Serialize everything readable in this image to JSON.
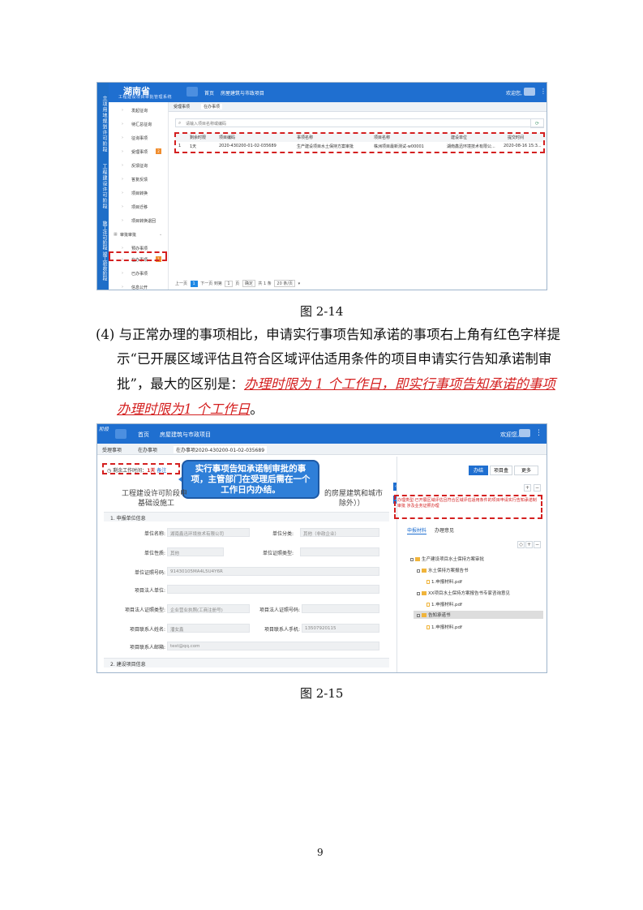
{
  "figure1": {
    "caption": "图 2-14",
    "side_labels": [
      "立项用地规划许可阶段",
      "工程建设许可阶段",
      "施工许可阶段",
      "竣工验收阶段"
    ],
    "header": {
      "logo": "湖南省",
      "logo_sub": "工程建设项目审批管理系统",
      "nav": [
        "首页",
        "房屋建筑与市政项目"
      ],
      "welcome": "欢迎您,"
    },
    "sidebar": [
      {
        "label": "发起征询",
        "badge": ""
      },
      {
        "label": "待汇总征询",
        "badge": ""
      },
      {
        "label": "征询事项",
        "badge": ""
      },
      {
        "label": "受理事项",
        "badge": "2"
      },
      {
        "label": "反馈征询",
        "badge": ""
      },
      {
        "label": "答复反馈",
        "badge": ""
      },
      {
        "label": "项目转换",
        "badge": ""
      },
      {
        "label": "项目迁移",
        "badge": ""
      },
      {
        "label": "项目转换退回",
        "badge": ""
      },
      {
        "label": "审批审批",
        "badge": ""
      },
      {
        "label": "预办事项",
        "badge": ""
      },
      {
        "label": "在办事项",
        "badge": "1"
      },
      {
        "label": "已办事项",
        "badge": ""
      },
      {
        "label": "信息公开",
        "badge": ""
      }
    ],
    "tabs": [
      "受理事项",
      "在办事项"
    ],
    "search_placeholder": "请输入项目名称或编码",
    "table": {
      "headers": [
        "剩余时限",
        "项目编码",
        "事项名称",
        "项目名称",
        "建设单位",
        "提交时间"
      ],
      "rows": [
        [
          "1",
          "1天",
          "2020-430200-01-02-035689",
          "生产建设项目水土保持方案审批",
          "株洲项目最新测试-w00001",
          "湖南鑫迅环境技术有限公...",
          "2020-08-16 15:3..."
        ]
      ]
    },
    "pager": {
      "prev": "上一页",
      "page": "1",
      "next": "下一页",
      "goto": "到第",
      "goto_val": "1",
      "page_unit": "页",
      "confirm": "确定",
      "total": "共 1 条",
      "per_page": "20 条/页"
    }
  },
  "paragraph": {
    "line1": "(4) 与正常办理的事项相比，申请实行事项告知承诺的事项右上角有红色字样提",
    "line2": "示“已开展区域评估且符合区域评估适用条件的项目申请实行告知承诺制审",
    "line3_prefix": "批”，最大的区别是：",
    "line3_red": "办理时限为 1 个工作日，即实行事项告知承诺的事项",
    "line4_red": "办理时限为1 个工作日",
    "line4_suffix": "。"
  },
  "figure2": {
    "caption": "图 2-15",
    "header": {
      "logo": "阶段",
      "nav": [
        "首页",
        "房屋建筑与市政项目"
      ],
      "welcome": "欢迎您,"
    },
    "tabs": [
      "受理事项",
      "在办事项",
      "在办事项2020-430200-01-02-035689"
    ],
    "time_label": "剩余工作时间：",
    "time_days": "1天",
    "time_note": "备注",
    "callout": "实行事项告知承诺制审批的事项，主管部门在受理后需在一个工作日内办结。",
    "form_title_l1": "工程建设许可阶段申",
    "form_title_l2": "基础设施工",
    "form_title_r1": "的房屋建筑和城市",
    "form_title_r2": "除外））",
    "sections": [
      "1. 申报单位信息",
      "2. 建设项目信息"
    ],
    "fields": [
      {
        "label": "单位名称:",
        "value": "湖南鑫迅环境技术有限公司"
      },
      {
        "label": "单位分类:",
        "value": "其他（非政企业）"
      },
      {
        "label": "单位性质:",
        "value": "其他"
      },
      {
        "label": "单位证照类型:",
        "value": ""
      },
      {
        "label": "单位证照号码:",
        "value": "91430105MA4L5U4Y6R"
      },
      {
        "label": "项目法人单位:",
        "value": ""
      },
      {
        "label": "项目法人证照类型:",
        "value": "企业营业执照(工商注册号)"
      },
      {
        "label": "项目法人证照号码:",
        "value": ""
      },
      {
        "label": "项目联系人姓名:",
        "value": "潘女鑫"
      },
      {
        "label": "项目联系人手机:",
        "value": "13507920115"
      },
      {
        "label": "项目联系人邮箱:",
        "value": "test@qq.com"
      }
    ],
    "right": {
      "buttons": [
        "办结",
        "项目盒",
        "更多"
      ],
      "red_notice": "办理类型:已开展区域评估且符合区域评估适用条件的项目申请实行告知承诺制审批 涉及业务证照办理",
      "tabs": [
        "申报材料",
        "办理意见"
      ],
      "tree": [
        "生产建设项目水土保持方案审批",
        "水土保持方案报告书",
        "1.申报材料.pdf",
        "XX项目水土保持方案报告书专家咨询意见",
        "1.申报材料.pdf",
        "告知承诺书",
        "1.申报材料.pdf"
      ]
    }
  },
  "page_number": "9"
}
